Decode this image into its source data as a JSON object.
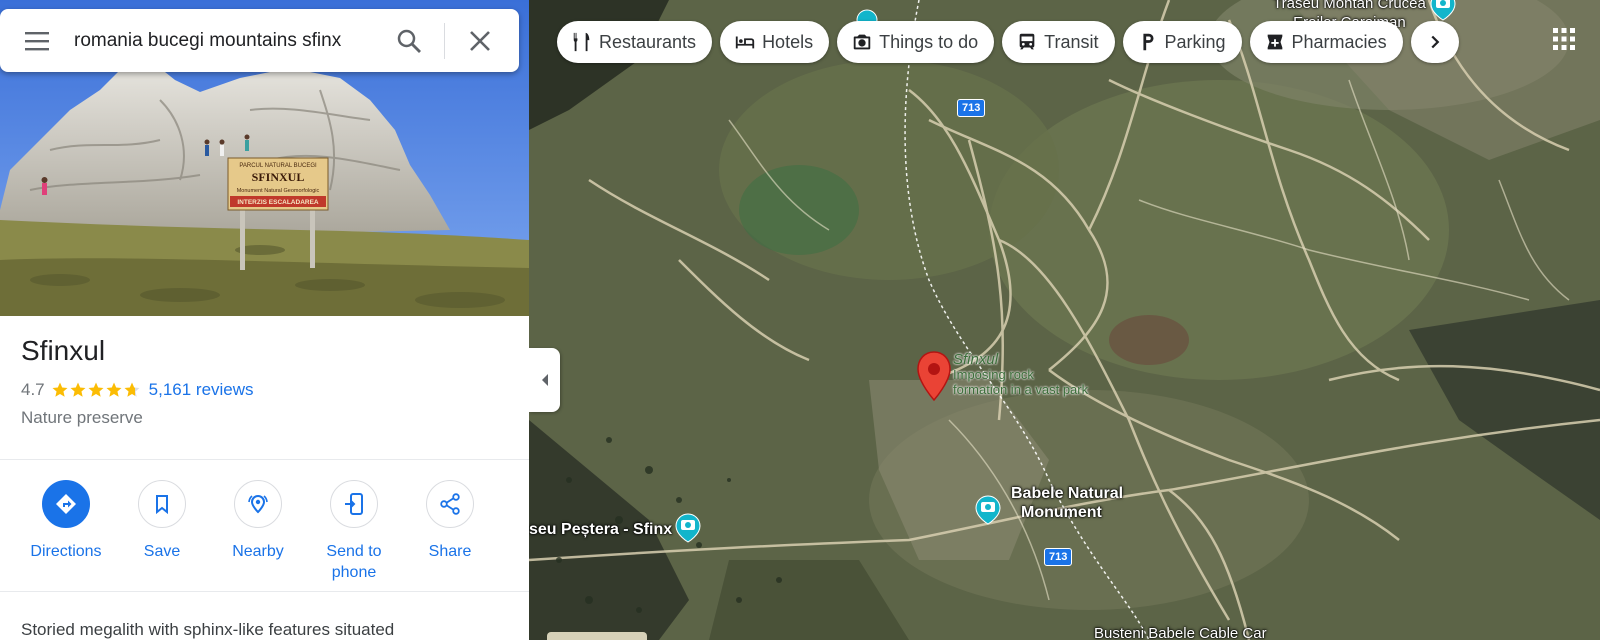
{
  "search": {
    "query": "romania bucegi mountains sfinx"
  },
  "place": {
    "name": "Sfinxul",
    "rating": "4.7",
    "rating_value": 4.7,
    "reviews": "5,161 reviews",
    "category": "Nature preserve",
    "description": "Storied megalith with sphinx-like features situated",
    "photo_sign_lines": [
      "PARCUL NATURAL BUCEGI",
      "SFINXUL",
      "Monument Natural Geomorfologic",
      "INTERZIS ESCALADAREA"
    ]
  },
  "actions": [
    {
      "label": "Directions",
      "icon": "directions-icon"
    },
    {
      "label": "Save",
      "icon": "bookmark-icon"
    },
    {
      "label": "Nearby",
      "icon": "nearby-icon"
    },
    {
      "label": "Send to phone",
      "icon": "send-to-phone-icon"
    },
    {
      "label": "Share",
      "icon": "share-icon"
    }
  ],
  "chips": [
    {
      "label": "Restaurants",
      "icon": "restaurant-icon"
    },
    {
      "label": "Hotels",
      "icon": "hotel-icon"
    },
    {
      "label": "Things to do",
      "icon": "camera-icon"
    },
    {
      "label": "Transit",
      "icon": "transit-icon"
    },
    {
      "label": "Parking",
      "icon": "parking-icon"
    },
    {
      "label": "Pharmacies",
      "icon": "pharmacy-icon"
    }
  ],
  "map": {
    "selected_title": "Sfinxul",
    "selected_desc_1": "Imposing rock",
    "selected_desc_2": "formation in a vast park",
    "babele_1": "Babele Natural",
    "babele_2": "Monument",
    "pestera": "seu Peștera - Sfinx",
    "traseu_1": "Traseu Montan Crucea",
    "traseu_2": "Eroilor Caraiman",
    "cable_car": "Busteni Babele Cable Car",
    "road_713_a": "713",
    "road_713_b": "713"
  },
  "colors": {
    "accent": "#1a73e8",
    "star": "#fbbc04",
    "pin": "#ea4335"
  }
}
